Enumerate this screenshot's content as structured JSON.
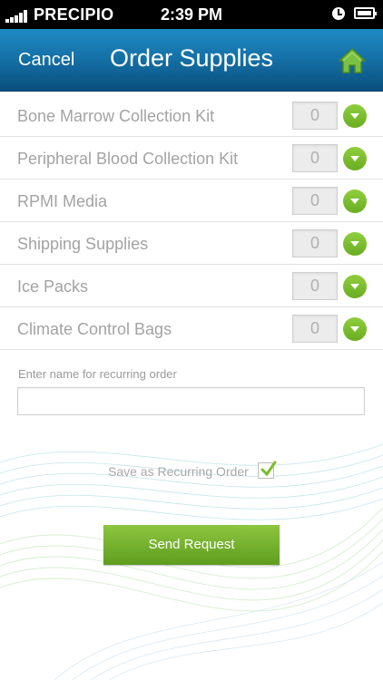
{
  "status_bar": {
    "carrier": "PRECIPIO",
    "time": "2:39 PM"
  },
  "nav": {
    "cancel_label": "Cancel",
    "title": "Order Supplies",
    "home_icon": "home-icon"
  },
  "items": [
    {
      "label": "Bone Marrow Collection Kit",
      "qty": "0"
    },
    {
      "label": "Peripheral Blood Collection Kit",
      "qty": "0"
    },
    {
      "label": "RPMI Media",
      "qty": "0"
    },
    {
      "label": "Shipping Supplies",
      "qty": "0"
    },
    {
      "label": "Ice Packs",
      "qty": "0"
    },
    {
      "label": "Climate Control Bags",
      "qty": "0"
    }
  ],
  "recurring": {
    "label": "Enter name for recurring order",
    "value": "",
    "save_label": "Save as Recurring Order",
    "checked": true
  },
  "send_label": "Send Request",
  "colors": {
    "nav_blue": "#1572a8",
    "accent_green": "#7bbd2e"
  }
}
